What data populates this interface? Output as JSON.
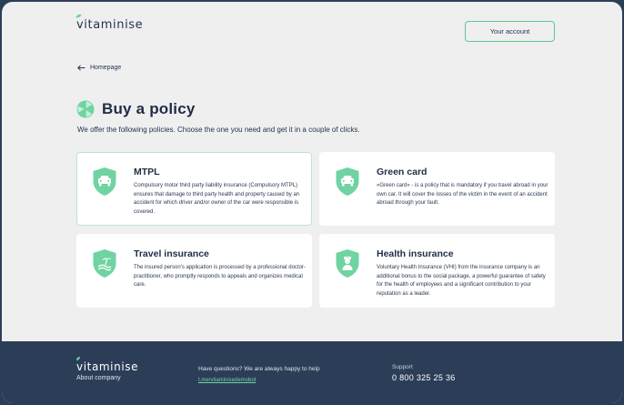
{
  "header": {
    "logo_text": "vitaminise",
    "account_button": "Your account"
  },
  "breadcrumb": {
    "label": "Homepage",
    "icon": "arrow-left-icon"
  },
  "page": {
    "title": "Buy a policy",
    "subtitle": "We offer the following policies. Choose the one you need and get it in a couple of clicks."
  },
  "policies": [
    {
      "title": "MTPL",
      "icon": "car-shield-icon",
      "description": "Compulsory motor third party liability insurance (Compulsory MTPL) ensures that damage to third party health and property caused by an accident for which driver and/or owner of the car were responsible is covered."
    },
    {
      "title": "Green card",
      "icon": "car-shield-icon",
      "description": "«Green card» - is a policy that is mandatory if you travel abroad in your own car. It will cover the losses of the victim in the event of an accident abroad through your fault."
    },
    {
      "title": "Travel insurance",
      "icon": "travel-shield-icon",
      "description": "The insured person's application is processed by a professional doctor-practitioner, who promptly responds to appeals and organizes medical care."
    },
    {
      "title": "Health insurance",
      "icon": "doctor-shield-icon",
      "description": "Voluntary Health Insurance (VHI) from the insurance company is an additional bonus to the social package, a powerful guarantee of safety for the health of employees and a significant contribution to your reputation as a leader."
    }
  ],
  "footer": {
    "logo_text": "vitaminise",
    "about": "About company",
    "questions": "Have questions? We are always happy to help",
    "link": "t.me/vitaminisedemobot",
    "support_label": "Support",
    "phone": "0 800 325 25 36"
  },
  "colors": {
    "accent": "#6fd3a2",
    "dark": "#2c3e57",
    "background": "#efefef"
  }
}
